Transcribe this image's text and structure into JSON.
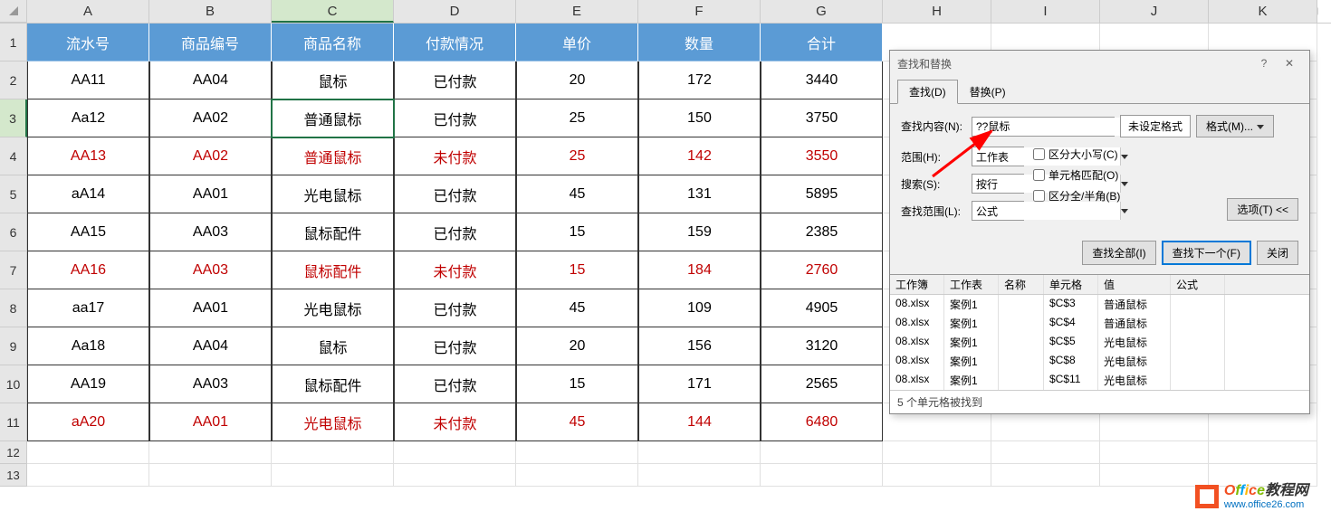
{
  "columns": [
    "A",
    "B",
    "C",
    "D",
    "E",
    "F",
    "G",
    "H",
    "I",
    "J",
    "K"
  ],
  "headers": [
    "流水号",
    "商品编号",
    "商品名称",
    "付款情况",
    "单价",
    "数量",
    "合计"
  ],
  "rows": [
    {
      "n": 2,
      "c": [
        "AA11",
        "AA04",
        "鼠标",
        "已付款",
        "20",
        "172",
        "3440"
      ],
      "red": false
    },
    {
      "n": 3,
      "c": [
        "Aa12",
        "AA02",
        "普通鼠标",
        "已付款",
        "25",
        "150",
        "3750"
      ],
      "red": false,
      "active": 2
    },
    {
      "n": 4,
      "c": [
        "AA13",
        "AA02",
        "普通鼠标",
        "未付款",
        "25",
        "142",
        "3550"
      ],
      "red": true
    },
    {
      "n": 5,
      "c": [
        "aA14",
        "AA01",
        "光电鼠标",
        "已付款",
        "45",
        "131",
        "5895"
      ],
      "red": false
    },
    {
      "n": 6,
      "c": [
        "AA15",
        "AA03",
        "鼠标配件",
        "已付款",
        "15",
        "159",
        "2385"
      ],
      "red": false
    },
    {
      "n": 7,
      "c": [
        "AA16",
        "AA03",
        "鼠标配件",
        "未付款",
        "15",
        "184",
        "2760"
      ],
      "red": true
    },
    {
      "n": 8,
      "c": [
        "aa17",
        "AA01",
        "光电鼠标",
        "已付款",
        "45",
        "109",
        "4905"
      ],
      "red": false
    },
    {
      "n": 9,
      "c": [
        "Aa18",
        "AA04",
        "鼠标",
        "已付款",
        "20",
        "156",
        "3120"
      ],
      "red": false
    },
    {
      "n": 10,
      "c": [
        "AA19",
        "AA03",
        "鼠标配件",
        "已付款",
        "15",
        "171",
        "2565"
      ],
      "red": false
    },
    {
      "n": 11,
      "c": [
        "aA20",
        "AA01",
        "光电鼠标",
        "未付款",
        "45",
        "144",
        "6480"
      ],
      "red": true
    }
  ],
  "empty_rows": [
    12,
    13
  ],
  "dialog": {
    "title": "查找和替换",
    "tab_find": "查找(D)",
    "tab_replace": "替换(P)",
    "find_label": "查找内容(N):",
    "find_value": "??鼠标",
    "no_format": "未设定格式",
    "format_btn": "格式(M)...",
    "scope_label": "范围(H):",
    "scope_value": "工作表",
    "search_label": "搜索(S):",
    "search_value": "按行",
    "lookin_label": "查找范围(L):",
    "lookin_value": "公式",
    "chk_case": "区分大小写(C)",
    "chk_whole": "单元格匹配(O)",
    "chk_width": "区分全/半角(B)",
    "options_btn": "选项(T) <<",
    "find_all": "查找全部(I)",
    "find_next": "查找下一个(F)",
    "close_btn": "关闭",
    "results": {
      "cols": [
        "工作簿",
        "工作表",
        "名称",
        "单元格",
        "值",
        "公式"
      ],
      "rows": [
        [
          "08.xlsx",
          "案例1",
          "",
          "$C$3",
          "普通鼠标",
          ""
        ],
        [
          "08.xlsx",
          "案例1",
          "",
          "$C$4",
          "普通鼠标",
          ""
        ],
        [
          "08.xlsx",
          "案例1",
          "",
          "$C$5",
          "光电鼠标",
          ""
        ],
        [
          "08.xlsx",
          "案例1",
          "",
          "$C$8",
          "光电鼠标",
          ""
        ],
        [
          "08.xlsx",
          "案例1",
          "",
          "$C$11",
          "光电鼠标",
          ""
        ]
      ]
    },
    "status": "5 个单元格被找到"
  },
  "watermark": {
    "main_prefix": "Office",
    "main_suffix": "教程网",
    "url": "www.office26.com"
  }
}
